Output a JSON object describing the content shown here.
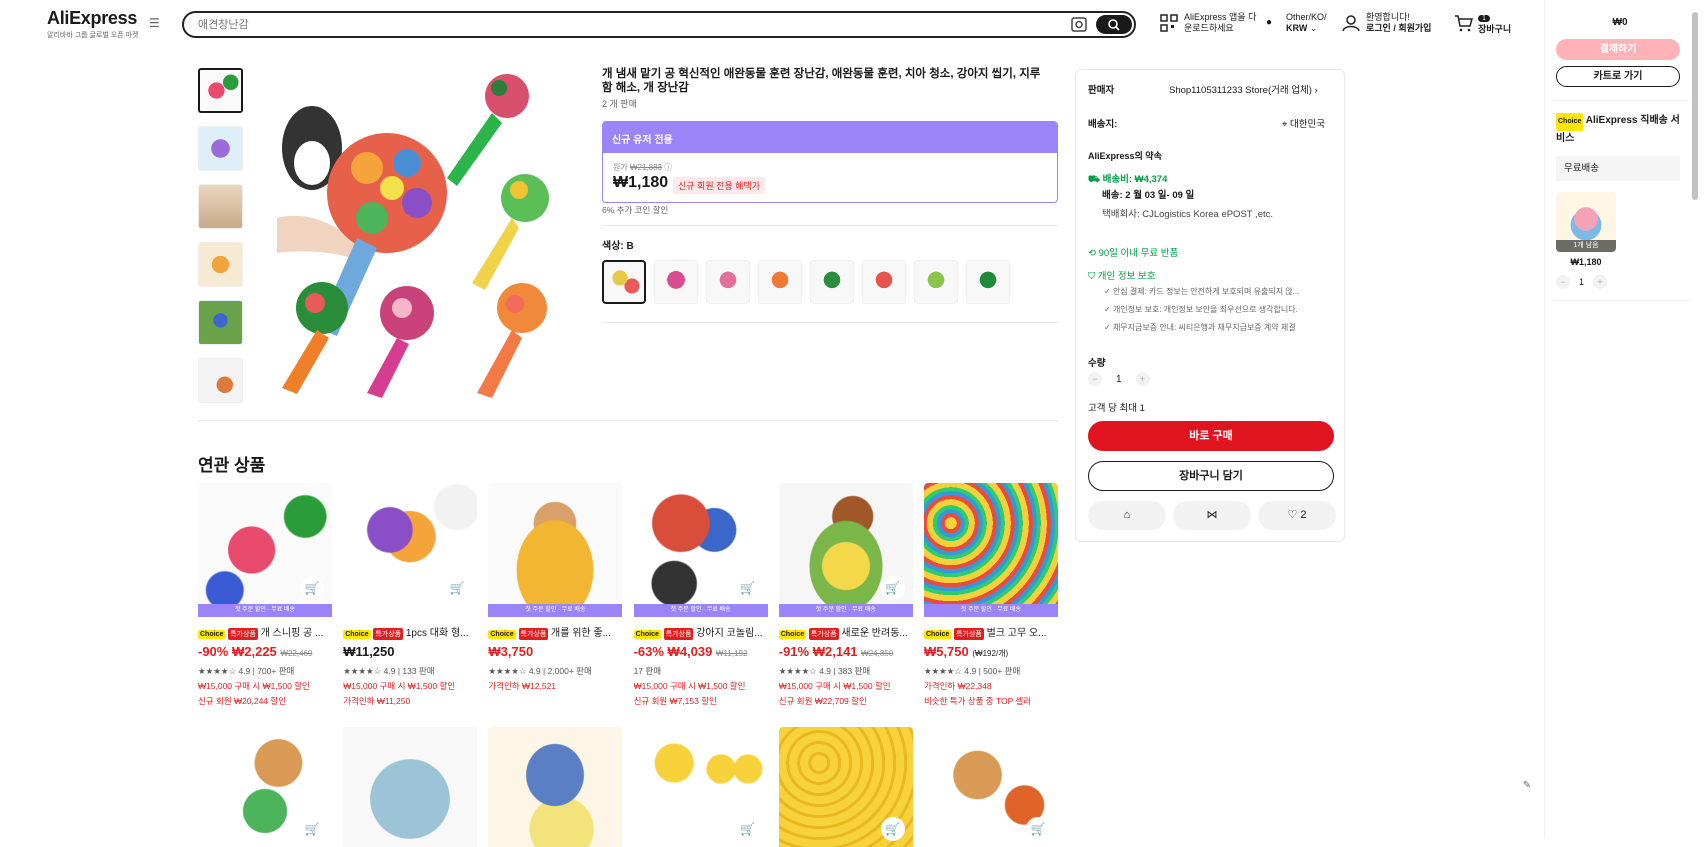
{
  "header": {
    "logo": "AliExpress",
    "logo_sub": "알리바바 그룹 글로벌 오픈 마켓",
    "search_placeholder": "애견장난감",
    "app_download": "AliExpress 앱을 다\n운로드하세요",
    "region_top": "Other/KO/",
    "region_bottom": "KRW",
    "welcome": "환영합니다!",
    "login": "로그인 / 회원가입",
    "cart_count": "1",
    "cart_label": "장바구니"
  },
  "product": {
    "title": "개 냄새 맡기 공 혁신적인 애완동물 훈련 장난감, 애완동물 훈련, 치아 청소, 강아지 씹기, 지루함 해소, 개 장난감",
    "sold": "2 개 판매",
    "new_user_label": "신규 유저 전용",
    "orig_label": "원가",
    "orig_price": "₩21,883",
    "price": "₩1,180",
    "price_tag": "신규 회원 전용 혜택가",
    "coin_discount": "6% 추가 코인 할인",
    "color_label": "색상: B"
  },
  "buybox": {
    "seller_label": "판매자",
    "seller_name": "Shop1105311233 Store(거래 업체)",
    "ship_to_label": "배송지:",
    "ship_to_value": "대한민국",
    "promise": "AliExpress의 약속",
    "shipping_fee": "배송비: ₩4,374",
    "delivery": "배송: 2 월 03 일- 09 일",
    "courier": "택배회사: CJLogistics Korea ePOST ,etc.",
    "free_return": "90일 이내 무료 반품",
    "privacy": "개인 정보 보호",
    "check1": "안심 결제: 카드 정보는 안전하게 보호되며 유출되지 않...",
    "check2": "개인정보 보호: 개인정보 보안을 최우선으로 생각합니다.",
    "check3": "채무지급보증 안내: 씨티은행과 채무지급보증 계약 체결",
    "qty_label": "수량",
    "qty": "1",
    "max": "고객 당 최대 1",
    "buy_now": "바로 구매",
    "add_cart": "장바구니 담기",
    "wish_count": "2"
  },
  "related": {
    "title": "연관 상품",
    "items": [
      {
        "title": "개 스니핑 공 ...",
        "price": "₩2,225",
        "discount": "-90%",
        "orig": "₩22,469",
        "meta": "★★★★☆ 4.9 | 700+ 판매",
        "promo1": "₩15,000 구매 시 ₩1,500 할인",
        "promo2": "신규 회원 ₩20,244 할인"
      },
      {
        "title": "1pcs 대화 형...",
        "price": "₩11,250",
        "discount": "",
        "orig": "",
        "meta": "★★★★☆ 4.9 | 133 판매",
        "promo1": "₩15,000 구매 시 ₩1,500 할인",
        "promo2": "가격인하 ₩11,250"
      },
      {
        "title": "개를 위한 좋...",
        "price": "₩3,750",
        "discount": "",
        "orig": "",
        "meta": "★★★★☆ 4.9 | 2,000+ 판매",
        "promo1": "가격인하 ₩12,521",
        "promo2": ""
      },
      {
        "title": "강아지 코놀림...",
        "price": "₩4,039",
        "discount": "-63%",
        "orig": "₩11,192",
        "meta": "17 판매",
        "promo1": "₩15,000 구매 시 ₩1,500 할인",
        "promo2": "신규 회원 ₩7,153 할인"
      },
      {
        "title": "새로운 반려동...",
        "price": "₩2,141",
        "discount": "-91%",
        "orig": "₩24,850",
        "meta": "★★★★☆ 4.9 | 383 판매",
        "promo1": "₩15,000 구매 시 ₩1,500 할인",
        "promo2": "신규 회원 ₩22,709 할인"
      },
      {
        "title": "벌크 고무 오...",
        "price": "₩5,750",
        "discount": "",
        "orig": "",
        "unit": "(₩192/개)",
        "meta": "★★★★☆ 4.9 | 500+ 판매",
        "promo1": "가격인하 ₩22,348",
        "promo2": "비슷한 특가 상품 중 TOP 셀러"
      }
    ],
    "banner": "첫 주문 할인 · 무료 배송",
    "choice_badge": "Choice",
    "deal_badge": "특가상품"
  },
  "cart_sidebar": {
    "total": "₩0",
    "checkout": "결제하기",
    "go_cart": "카트로 가기",
    "service_badge": "Choice",
    "service": "AliExpress 직배송 서비스",
    "free_shipping": "무료배송",
    "left": "1개 남음",
    "item_price": "₩1,180",
    "item_qty": "1"
  },
  "colors": {
    "accent": "#e0141e",
    "purple": "#9b84f7",
    "green": "#00a046"
  }
}
